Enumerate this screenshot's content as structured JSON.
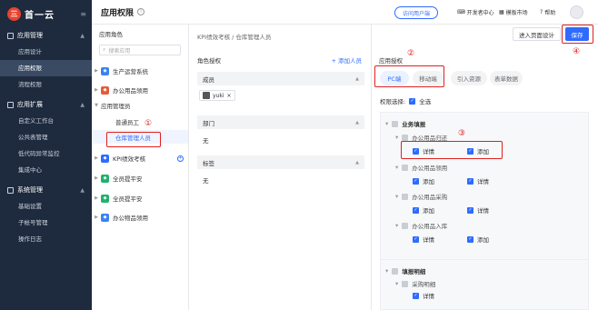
{
  "brand": {
    "mark": "三",
    "name": "首一云"
  },
  "sidebar": {
    "collapse": "≡",
    "groups": [
      {
        "label": "应用管理",
        "items": [
          "应用设计",
          "应用权限",
          "流程权限"
        ]
      },
      {
        "label": "应用扩展",
        "items": [
          "自定义工作台",
          "公共表管理",
          "低代码异常监控",
          "集成中心"
        ]
      },
      {
        "label": "系统管理",
        "items": [
          "基础设置",
          "子帐号管理",
          "操作日志"
        ]
      }
    ]
  },
  "header": {
    "title": "应用权限",
    "portal": "访问用户端",
    "links": [
      "开发者中心",
      "模板市场",
      "帮助"
    ]
  },
  "role_panel": {
    "title": "应用角色",
    "search_placeholder": "搜索应用",
    "apps": [
      "生产运营系统",
      "办公用品领用"
    ],
    "sub_group": "应用管理员",
    "roles": [
      "普通员工",
      "仓库管理人员"
    ],
    "more_apps": [
      "KPI绩效考核",
      "全员提平安",
      "全员提平安",
      "办公物品领用"
    ]
  },
  "middle": {
    "breadcrumb": "KPI绩效考核 / 仓库管理人员",
    "section": "角色授权",
    "add_member": "+ 添加人员",
    "members_title": "成员",
    "member_name": "yuki",
    "dept_title": "部门",
    "dept_value": "无",
    "tag_title": "标签",
    "tag_value": "无"
  },
  "right": {
    "enter_design": "进入页面设计",
    "save": "保存",
    "section": "应用授权",
    "tabs": [
      "PC端",
      "移动端",
      "引入资源",
      "表单数据"
    ],
    "scope_label": "权限选择:",
    "select_all": "全选",
    "group1": "业务填报",
    "forms": [
      {
        "name": "办公用品归还",
        "perms": [
          "详情",
          "添加"
        ]
      },
      {
        "name": "办公用品领用",
        "perms": [
          "添加",
          "详情"
        ]
      },
      {
        "name": "办公用品采购",
        "perms": [
          "添加",
          "详情"
        ]
      },
      {
        "name": "办公用品入库",
        "perms": [
          "详情",
          "添加"
        ]
      }
    ],
    "group2": "填报明细",
    "detail_form": "采购明细",
    "detail_perm": "详情"
  },
  "annotations": [
    "①",
    "②",
    "③",
    "④"
  ],
  "colors": {
    "accent": "#2f6bff",
    "sidebar": "#1e2a3e",
    "annotation": "#e02020"
  }
}
